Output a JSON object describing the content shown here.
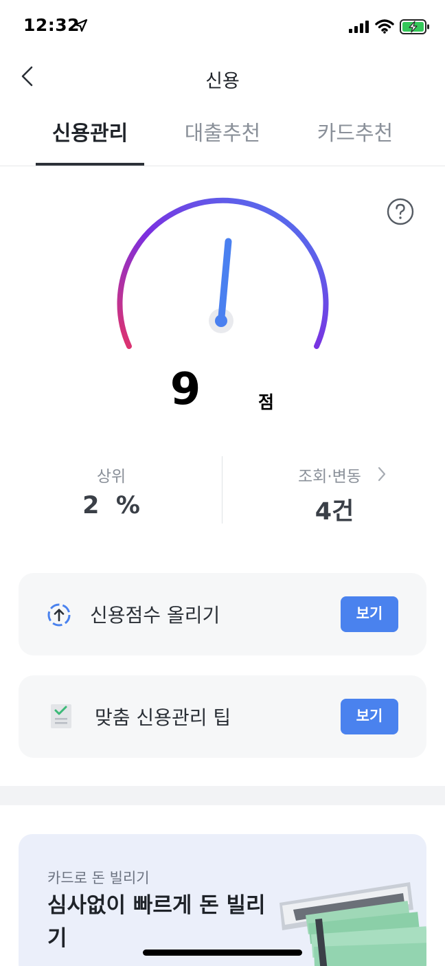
{
  "status_bar": {
    "time": "12:32"
  },
  "nav": {
    "title": "신용"
  },
  "tabs": [
    {
      "label": "신용관리",
      "active": true
    },
    {
      "label": "대출추천",
      "active": false
    },
    {
      "label": "카드추천",
      "active": false
    }
  ],
  "score": {
    "value": "9",
    "unit": "점",
    "gauge_level": 0.52
  },
  "stats": {
    "rank_label": "상위",
    "rank_value": "2  %",
    "inquiry_label": "조회·변동",
    "inquiry_value": "4건"
  },
  "cards": [
    {
      "title": "신용점수 올리기",
      "button": "보기",
      "icon": "score-up-icon"
    },
    {
      "title": "맞춤 신용관리 팁",
      "button": "보기",
      "icon": "checklist-icon"
    }
  ],
  "banner": {
    "subtitle": "카드로 돈 빌리기",
    "title": "심사없이 빠르게 돈 빌리기"
  },
  "colors": {
    "accent": "#4a82ee",
    "gauge_start": "#e0336b",
    "gauge_mid": "#7b2fe0",
    "gauge_end": "#4a80f0"
  }
}
